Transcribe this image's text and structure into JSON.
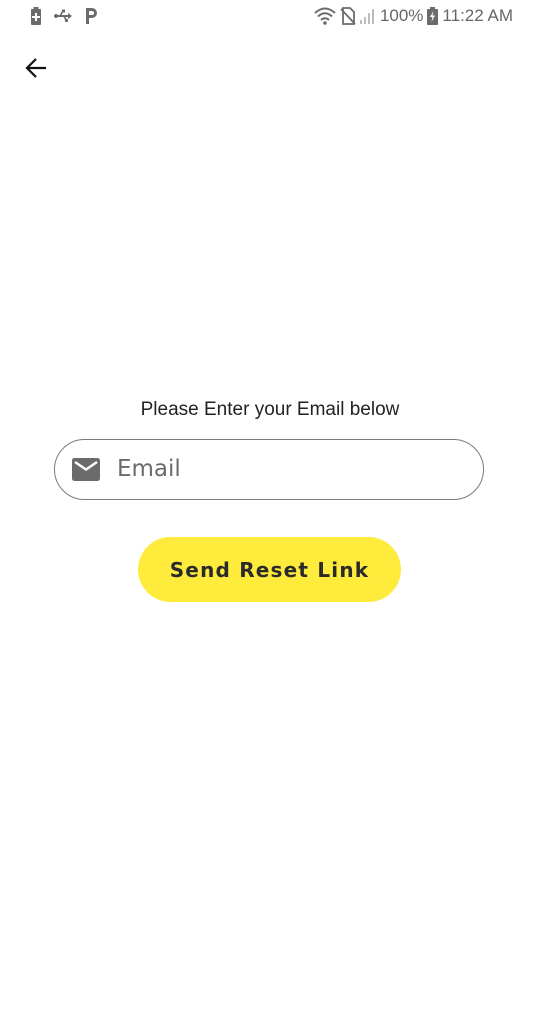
{
  "status_bar": {
    "left_icons": [
      "battery-saver-icon",
      "usb-icon",
      "parking-icon"
    ],
    "right_icons": [
      "wifi-icon",
      "no-sim-icon",
      "signal-icon",
      "battery-icon"
    ],
    "battery_percent": "100%",
    "time": "11:22 AM"
  },
  "header": {
    "back_icon": "arrow-back-icon"
  },
  "form": {
    "prompt": "Please Enter your Email below",
    "email": {
      "icon": "mail-icon",
      "placeholder": "Email",
      "value": ""
    },
    "submit_label": "Send Reset Link"
  },
  "colors": {
    "accent": "#ffeb3b",
    "field_border": "#7a7a7a",
    "icon_gray": "#6b6b6b"
  }
}
